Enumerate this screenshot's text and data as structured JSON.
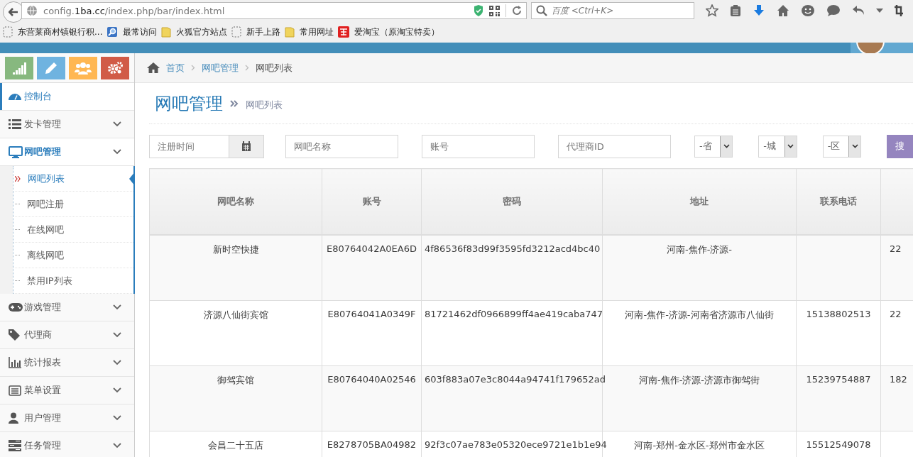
{
  "browser": {
    "url": {
      "prefix": "config.",
      "domain": "1ba.cc",
      "path": "/index.php/bar/index.html"
    },
    "search_placeholder": "百度 <Ctrl+K>",
    "bookmarks": [
      {
        "label": "东营莱商村镇银行积...",
        "kind": "page"
      },
      {
        "label": "最常访问",
        "kind": "smart"
      },
      {
        "label": "火狐官方站点",
        "kind": "folder"
      },
      {
        "label": "新手上路",
        "kind": "page"
      },
      {
        "label": "常用网址",
        "kind": "folder"
      },
      {
        "label": "爱淘宝（原淘宝特卖）",
        "kind": "taobao"
      }
    ]
  },
  "shortcuts": [
    {
      "kind": "stats",
      "color": "#87b87f"
    },
    {
      "kind": "edit",
      "color": "#6fb3e0"
    },
    {
      "kind": "users",
      "color": "#ffb752"
    },
    {
      "kind": "settings",
      "color": "#d15b47"
    }
  ],
  "breadcrumb": [
    {
      "label": "首页",
      "selected": false
    },
    {
      "label": "网吧管理",
      "selected": false
    },
    {
      "label": "网吧列表",
      "selected": true
    }
  ],
  "sidebar": [
    {
      "label": "控制台",
      "kind": "link",
      "selected": true,
      "expanded": false
    },
    {
      "label": "发卡管理",
      "kind": "group",
      "selected": false,
      "expanded": false
    },
    {
      "label": "网吧管理",
      "kind": "group",
      "selected": false,
      "expanded": true,
      "children": [
        {
          "label": "网吧列表",
          "selected": true
        },
        {
          "label": "网吧注册",
          "selected": false
        },
        {
          "label": "在线网吧",
          "selected": false
        },
        {
          "label": "离线网吧",
          "selected": false
        },
        {
          "label": "禁用IP列表",
          "selected": false
        }
      ]
    },
    {
      "label": "游戏管理",
      "kind": "group",
      "selected": false,
      "expanded": false
    },
    {
      "label": "代理商",
      "kind": "group",
      "selected": false,
      "expanded": false
    },
    {
      "label": "统计报表",
      "kind": "group",
      "selected": false,
      "expanded": false
    },
    {
      "label": "菜单设置",
      "kind": "group",
      "selected": false,
      "expanded": false
    },
    {
      "label": "用户管理",
      "kind": "group",
      "selected": false,
      "expanded": false
    },
    {
      "label": "任务管理",
      "kind": "group",
      "selected": false,
      "expanded": false
    }
  ],
  "page_title": "网吧管理",
  "page_subtitle": "网吧列表",
  "filters": [
    {
      "kind": "date",
      "placeholder": "注册时间"
    },
    {
      "kind": "text",
      "placeholder": "网吧名称"
    },
    {
      "kind": "text",
      "placeholder": "账号"
    },
    {
      "kind": "text",
      "placeholder": "代理商ID"
    },
    {
      "kind": "select",
      "value": "-省"
    },
    {
      "kind": "select",
      "value": "-城"
    },
    {
      "kind": "select",
      "value": "-区"
    }
  ],
  "search_button": "搜",
  "table": {
    "columns": [
      "网吧名称",
      "账号",
      "密码",
      "地址",
      "联系电话"
    ],
    "rows": [
      {
        "name": "新时空快捷",
        "account": "E80764042A0EA6D",
        "password": "4f86536f83d99f3595fd3212acd4bc40",
        "address": "河南-焦作-济源-",
        "column_6": "22"
      },
      {
        "name": "济源八仙街宾馆",
        "account": "E80764041A0349F",
        "password": "81721462df0966899ff4ae419caba747",
        "address": "河南-焦作-济源-河南省济源市八仙街",
        "phone": "15138802513",
        "column_6": "22"
      },
      {
        "name": "御驾宾馆",
        "account": "E80764040A02546",
        "password": "603f883a07e3c8044a94741f179652ad",
        "address": "河南-焦作-济源-济源市御驾街",
        "phone": "15239754887",
        "column_6": "182"
      },
      {
        "name": "会昌二十五店",
        "account": "E8278705BA04982",
        "password": "92f3c07ae783e05320ece9721e1b1e94",
        "address": "河南-郑州-金水区-郑州市金水区",
        "phone": "15512549078"
      }
    ]
  }
}
